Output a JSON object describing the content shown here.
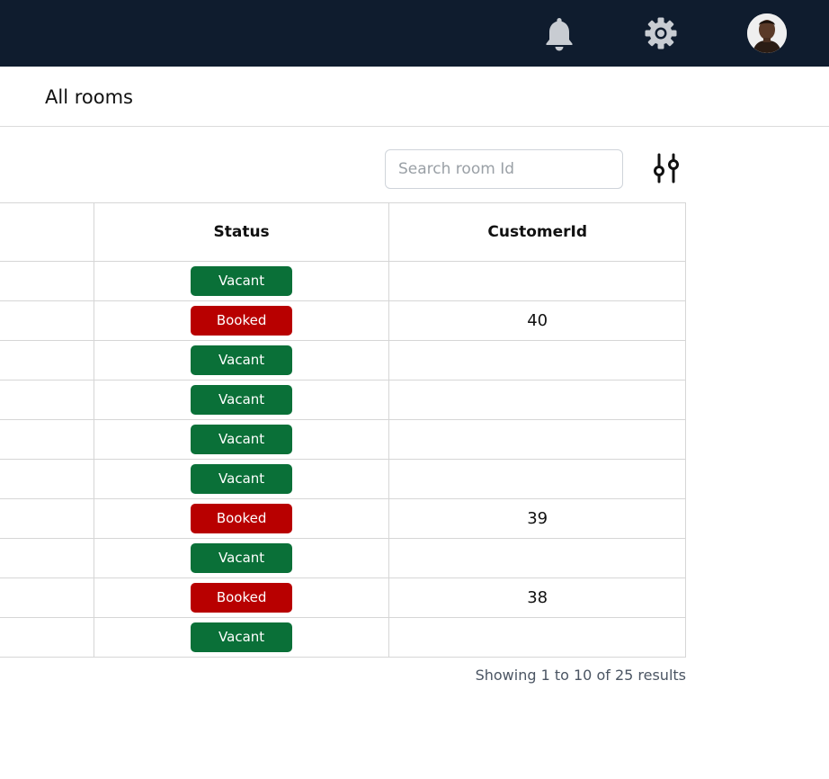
{
  "topbar": {
    "background": "#0f1c2e",
    "icons": [
      "bell-icon",
      "gear-icon",
      "user-avatar"
    ]
  },
  "header": {
    "title": "All rooms"
  },
  "search": {
    "placeholder": "Search room Id",
    "value": ""
  },
  "filter": {
    "icon": "sliders-icon"
  },
  "table": {
    "columns": [
      "",
      "Status",
      "CustomerId"
    ],
    "rows": [
      {
        "status": "Vacant",
        "customer_id": ""
      },
      {
        "status": "Booked",
        "customer_id": "40"
      },
      {
        "status": "Vacant",
        "customer_id": ""
      },
      {
        "status": "Vacant",
        "customer_id": ""
      },
      {
        "status": "Vacant",
        "customer_id": ""
      },
      {
        "status": "Vacant",
        "customer_id": ""
      },
      {
        "status": "Booked",
        "customer_id": "39"
      },
      {
        "status": "Vacant",
        "customer_id": ""
      },
      {
        "status": "Booked",
        "customer_id": "38"
      },
      {
        "status": "Vacant",
        "customer_id": ""
      }
    ],
    "status_colors": {
      "Vacant": "#0a7038",
      "Booked": "#b80000"
    }
  },
  "pagination": {
    "summary": "Showing 1 to 10 of 25 results"
  }
}
